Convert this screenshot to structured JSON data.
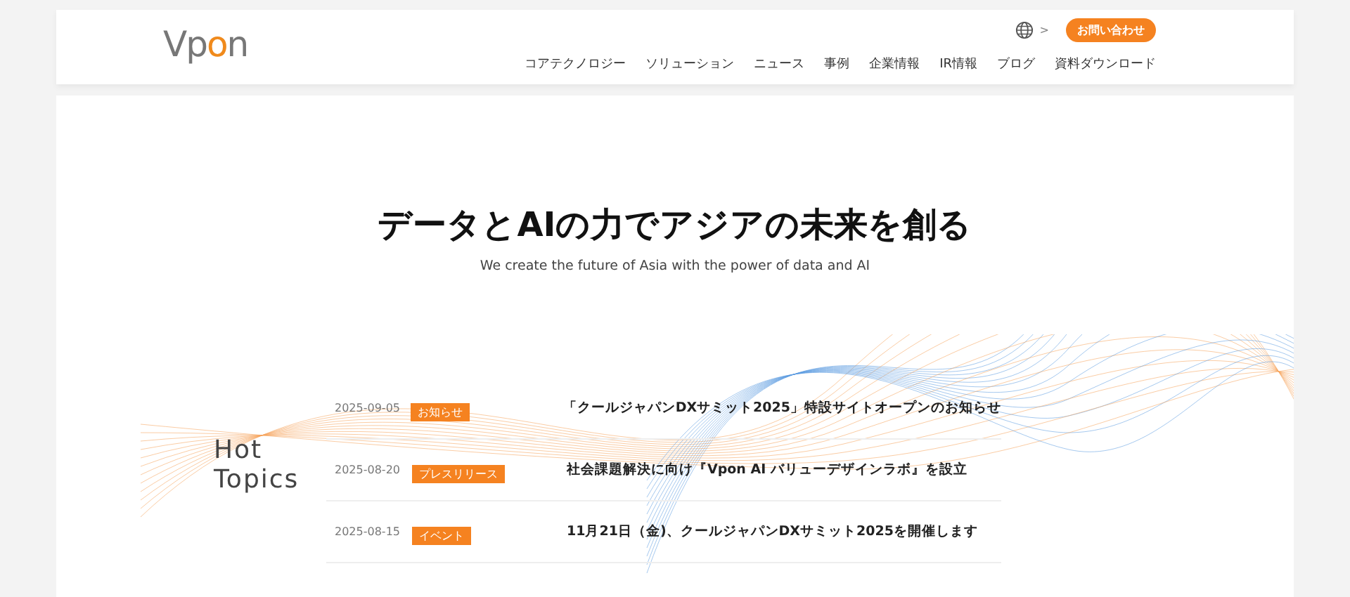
{
  "header": {
    "logo": [
      {
        "text": "Vp",
        "accent": false
      },
      {
        "text": "o",
        "accent": true
      },
      {
        "text": "n",
        "accent": false
      }
    ],
    "language_caret": ">",
    "contact_button": "お問い合わせ",
    "nav": [
      "コアテクノロジー",
      "ソリューション",
      "ニュース",
      "事例",
      "企業情報",
      "IR情報",
      "ブログ",
      "資料ダウンロード"
    ]
  },
  "hero": {
    "title": "データとAIの力でアジアの未来を創る",
    "subtitle": "We create the future of Asia with the power of data and AI"
  },
  "hot_topics": {
    "heading": "Hot Topics",
    "items": [
      {
        "date": "2025-09-05",
        "tag": "お知らせ",
        "title": "「クールジャパンDXサミット2025」特設サイトオープンのお知らせ"
      },
      {
        "date": "2025-08-20",
        "tag": "プレスリリース",
        "title": "社会課題解決に向け『Vpon AI バリューデザインラボ』を設立"
      },
      {
        "date": "2025-08-15",
        "tag": "イベント",
        "title": "11月21日（金)、クールジャパンDXサミット2025を開催します"
      }
    ]
  }
}
